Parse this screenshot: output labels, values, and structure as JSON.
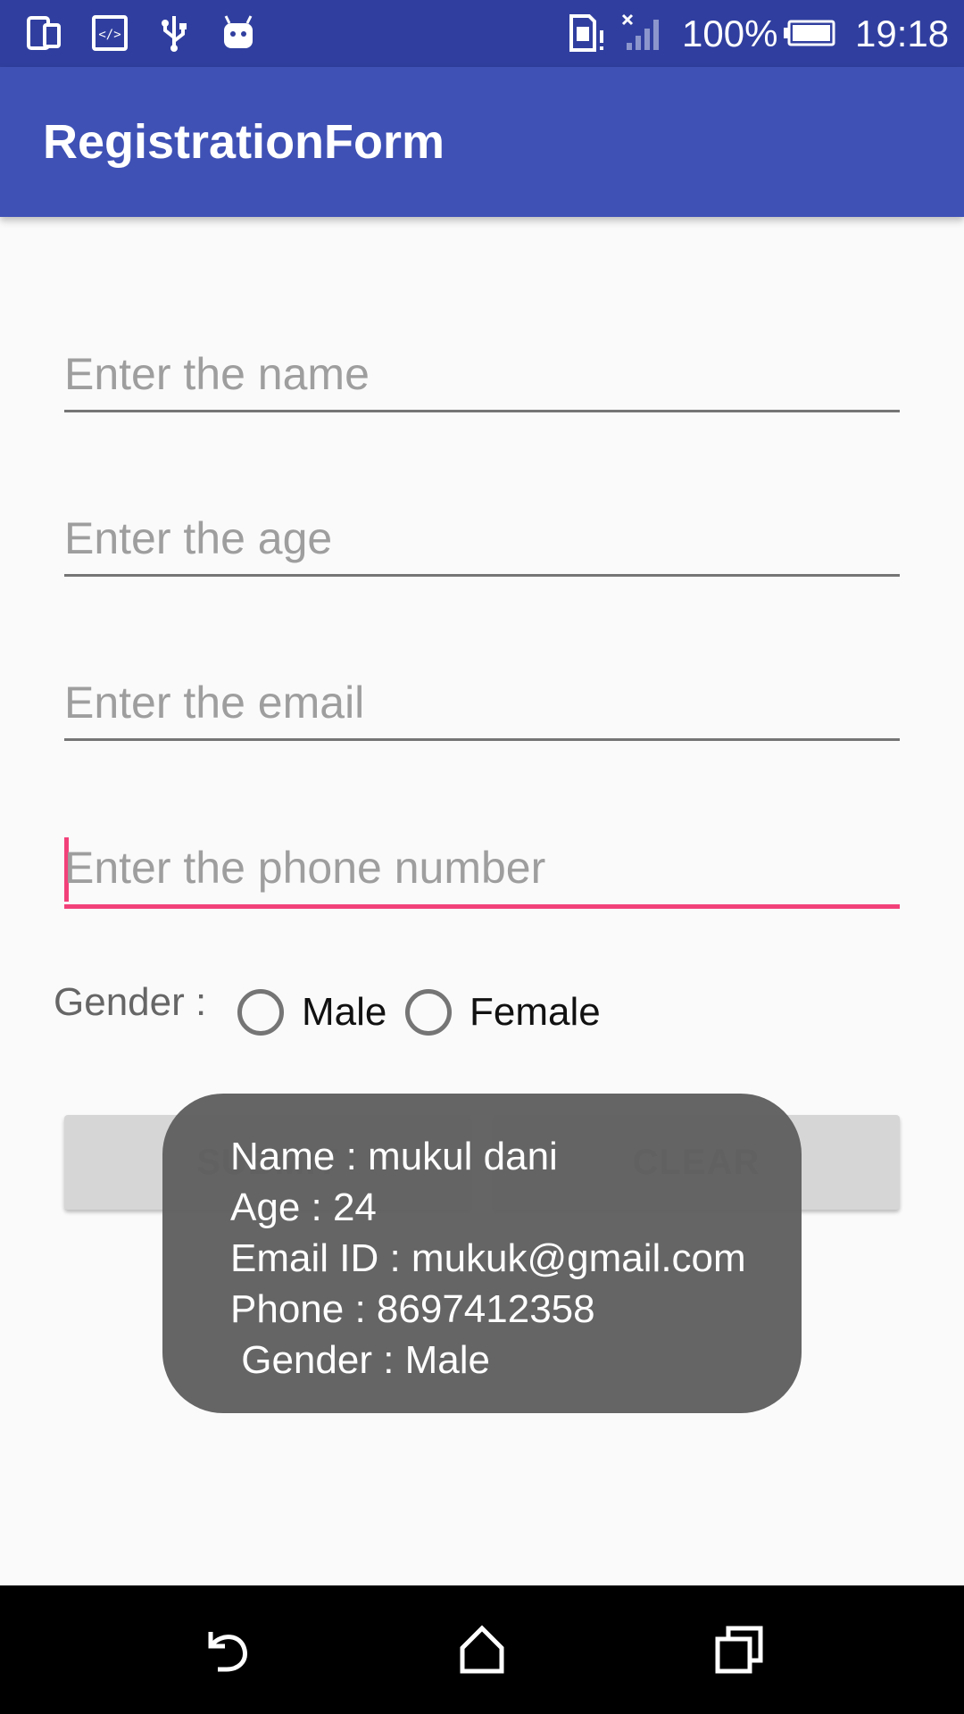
{
  "status_bar": {
    "battery_percent": "100%",
    "time": "19:18",
    "icons": [
      "phone-screen-icon",
      "developer-code-icon",
      "usb-icon",
      "android-debug-icon",
      "sim-alert-icon",
      "no-signal-icon",
      "battery-icon"
    ]
  },
  "app_bar": {
    "title": "RegistrationForm",
    "color": "#3f51b5",
    "status_color": "#303f9f"
  },
  "form": {
    "name_placeholder": "Enter the name",
    "age_placeholder": "Enter the age",
    "email_placeholder": "Enter the email",
    "phone_placeholder": "Enter the phone number",
    "gender_label": "Gender :",
    "gender_options": [
      "Male",
      "Female"
    ],
    "accent_color": "#f2417a"
  },
  "buttons": {
    "submit_label": "SUBMIT",
    "clear_label": "CLEAR"
  },
  "toast": {
    "lines": [
      "Name : mukul dani",
      "Age : 24",
      "Email ID : mukuk@gmail.com",
      "Phone : 8697412358",
      " Gender : Male"
    ]
  },
  "nav_bar": {
    "icons": [
      "back-icon",
      "home-icon",
      "recents-icon"
    ]
  }
}
